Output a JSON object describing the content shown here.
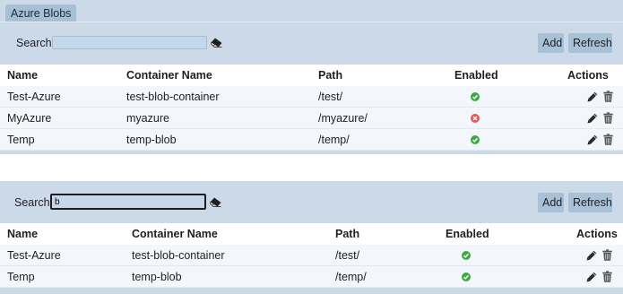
{
  "tab": {
    "label": "Azure Blobs"
  },
  "search": {
    "label": "Search"
  },
  "buttons": {
    "add": "Add",
    "refresh": "Refresh"
  },
  "columns": {
    "name": "Name",
    "container": "Container Name",
    "path": "Path",
    "enabled": "Enabled",
    "actions": "Actions"
  },
  "table1": {
    "search_value": "",
    "rows": [
      {
        "name": "Test-Azure",
        "container": "test-blob-container",
        "path": "/test/",
        "enabled": true
      },
      {
        "name": "MyAzure",
        "container": "myazure",
        "path": "/myazure/",
        "enabled": false
      },
      {
        "name": "Temp",
        "container": "temp-blob",
        "path": "/temp/",
        "enabled": true
      }
    ]
  },
  "table2": {
    "search_value": "b",
    "rows": [
      {
        "name": "Test-Azure",
        "container": "test-blob-container",
        "path": "/test/",
        "enabled": true
      },
      {
        "name": "Temp",
        "container": "temp-blob",
        "path": "/temp/",
        "enabled": true
      }
    ]
  },
  "colors": {
    "enabled": "#43a743",
    "disabled": "#e5565b",
    "panel": "#ccd9e8",
    "button": "#a9c1d6"
  },
  "icons": {
    "clear": "eraser-icon",
    "edit": "pencil-icon",
    "delete": "trash-icon",
    "enabled": "check-circle-icon",
    "disabled": "x-circle-icon"
  }
}
